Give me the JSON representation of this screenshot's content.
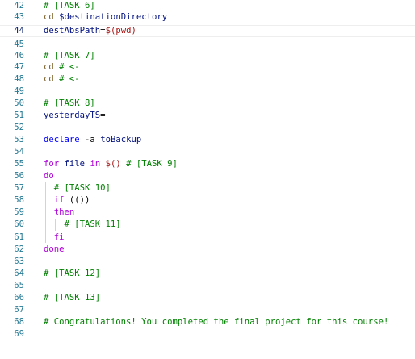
{
  "editor": {
    "lines": [
      {
        "num": "42",
        "tokens": [
          {
            "t": "# [TASK 6]",
            "c": "comment"
          }
        ]
      },
      {
        "num": "43",
        "tokens": [
          {
            "t": "cd",
            "c": "cmd"
          },
          {
            "t": " ",
            "c": "plain"
          },
          {
            "t": "$destinationDirectory",
            "c": "var"
          }
        ]
      },
      {
        "num": "44",
        "current": true,
        "tokens": [
          {
            "t": "destAbsPath",
            "c": "var"
          },
          {
            "t": "=",
            "c": "plain"
          },
          {
            "t": "$(pwd)",
            "c": "str"
          }
        ]
      },
      {
        "num": "45",
        "tokens": []
      },
      {
        "num": "46",
        "tokens": [
          {
            "t": "# [TASK 7]",
            "c": "comment"
          }
        ]
      },
      {
        "num": "47",
        "tokens": [
          {
            "t": "cd",
            "c": "cmd"
          },
          {
            "t": " ",
            "c": "plain"
          },
          {
            "t": "# <-",
            "c": "comment"
          }
        ]
      },
      {
        "num": "48",
        "tokens": [
          {
            "t": "cd",
            "c": "cmd"
          },
          {
            "t": " ",
            "c": "plain"
          },
          {
            "t": "# <-",
            "c": "comment"
          }
        ]
      },
      {
        "num": "49",
        "tokens": []
      },
      {
        "num": "50",
        "tokens": [
          {
            "t": "# [TASK 8]",
            "c": "comment"
          }
        ]
      },
      {
        "num": "51",
        "tokens": [
          {
            "t": "yesterdayTS",
            "c": "var"
          },
          {
            "t": "=",
            "c": "plain"
          }
        ]
      },
      {
        "num": "52",
        "tokens": []
      },
      {
        "num": "53",
        "tokens": [
          {
            "t": "declare",
            "c": "decl"
          },
          {
            "t": " ",
            "c": "plain"
          },
          {
            "t": "-a",
            "c": "flag"
          },
          {
            "t": " ",
            "c": "plain"
          },
          {
            "t": "toBackup",
            "c": "var"
          }
        ]
      },
      {
        "num": "54",
        "tokens": []
      },
      {
        "num": "55",
        "tokens": [
          {
            "t": "for",
            "c": "kw"
          },
          {
            "t": " ",
            "c": "plain"
          },
          {
            "t": "file",
            "c": "var"
          },
          {
            "t": " ",
            "c": "plain"
          },
          {
            "t": "in",
            "c": "kw"
          },
          {
            "t": " ",
            "c": "plain"
          },
          {
            "t": "$()",
            "c": "str"
          },
          {
            "t": " ",
            "c": "plain"
          },
          {
            "t": "# [TASK 9]",
            "c": "comment"
          }
        ]
      },
      {
        "num": "56",
        "tokens": [
          {
            "t": "do",
            "c": "kw"
          }
        ]
      },
      {
        "num": "57",
        "tokens": [
          {
            "t": "  ",
            "c": "plain"
          },
          {
            "t": "# [TASK 10]",
            "c": "comment"
          }
        ]
      },
      {
        "num": "58",
        "tokens": [
          {
            "t": "  ",
            "c": "plain"
          },
          {
            "t": "if",
            "c": "kw"
          },
          {
            "t": " ",
            "c": "plain"
          },
          {
            "t": "(())",
            "c": "plain"
          }
        ]
      },
      {
        "num": "59",
        "tokens": [
          {
            "t": "  ",
            "c": "plain"
          },
          {
            "t": "then",
            "c": "kw"
          }
        ]
      },
      {
        "num": "60",
        "tokens": [
          {
            "t": "    ",
            "c": "plain"
          },
          {
            "t": "# [TASK 11]",
            "c": "comment"
          }
        ]
      },
      {
        "num": "61",
        "tokens": [
          {
            "t": "  ",
            "c": "plain"
          },
          {
            "t": "fi",
            "c": "kw"
          }
        ]
      },
      {
        "num": "62",
        "tokens": [
          {
            "t": "done",
            "c": "kw"
          }
        ]
      },
      {
        "num": "63",
        "tokens": []
      },
      {
        "num": "64",
        "tokens": [
          {
            "t": "# [TASK 12]",
            "c": "comment"
          }
        ]
      },
      {
        "num": "65",
        "tokens": []
      },
      {
        "num": "66",
        "tokens": [
          {
            "t": "# [TASK 13]",
            "c": "comment"
          }
        ]
      },
      {
        "num": "67",
        "tokens": []
      },
      {
        "num": "68",
        "tokens": [
          {
            "t": "# Congratulations! You completed the final project for this course!",
            "c": "comment"
          }
        ]
      },
      {
        "num": "69",
        "tokens": []
      }
    ]
  },
  "colors": {
    "background": "#ffffff",
    "line_number": "#237893",
    "current_line_number": "#0b216f",
    "comment": "#008000",
    "keyword": "#af00db",
    "declare": "#0000ff",
    "variable": "#001080",
    "command": "#795e26"
  }
}
